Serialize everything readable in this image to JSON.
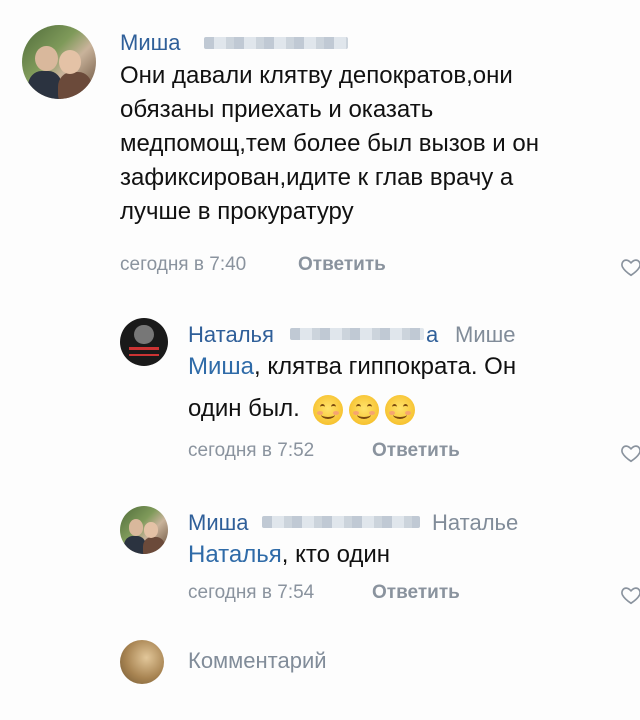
{
  "comments": [
    {
      "author": "Миша",
      "text": "Они давали клятву депократов,они обязаны приехать и оказать медпомощ,тем более был вызов и он зафиксирован,идите к глав врачу а лучше в прокуратуру",
      "text_lines": [
        "Они давали клятву депократов,они",
        "обязаны приехать и оказать",
        "медпомощ,тем более был вызов и он",
        "зафиксирован,идите к глав врачу а",
        "лучше в прокуратуру"
      ],
      "time": "сегодня в 7:40",
      "reply_label": "Ответить"
    },
    {
      "author_prefix": "Наталья",
      "author_suffix": "а",
      "reply_to": "Мише",
      "mention": "Миша",
      "text_line1_rest": ", клятва гиппократа. Он",
      "text_line2": "один был.",
      "emoji_count": 3,
      "time": "сегодня в 7:52",
      "reply_label": "Ответить"
    },
    {
      "author": "Миша",
      "reply_to": "Наталье",
      "mention": "Наталья",
      "text_rest": ", кто один",
      "time": "сегодня в 7:54",
      "reply_label": "Ответить"
    }
  ],
  "composer": {
    "placeholder": "Комментарий"
  },
  "icons": {
    "like": "heart-outline-icon",
    "emoji": "smiling-face-emoji"
  },
  "colors": {
    "author": "#2f5f99",
    "mention": "#2f6ba8",
    "meta": "#8a939e"
  }
}
